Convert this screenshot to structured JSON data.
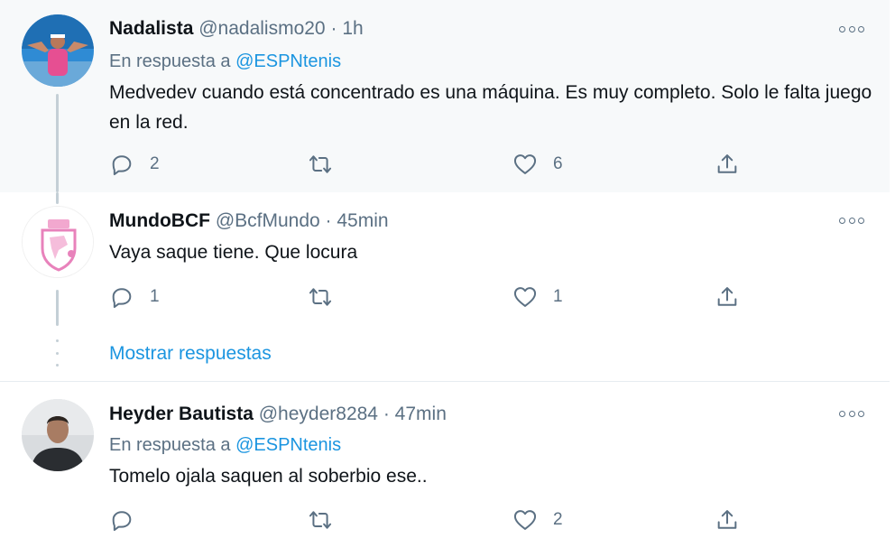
{
  "tweets": [
    {
      "name": "Nadalista",
      "handle": "@nadalismo20",
      "sep": "·",
      "time": "1h",
      "reply_prefix": "En respuesta a",
      "reply_to": "@ESPNtenis",
      "text": "Medvedev cuando está concentrado es una máquina. Es muy completo. Solo le falta juego en la red.",
      "replies": "2",
      "retweets": "",
      "likes": "6"
    },
    {
      "name": "MundoBCF",
      "handle": "@BcfMundo",
      "sep": "·",
      "time": "45min",
      "text": "Vaya saque tiene. Que locura",
      "replies": "1",
      "retweets": "",
      "likes": "1",
      "show_replies": "Mostrar respuestas"
    },
    {
      "name": "Heyder Bautista",
      "handle": "@heyder8284",
      "sep": "·",
      "time": "47min",
      "reply_prefix": "En respuesta a",
      "reply_to": "@ESPNtenis",
      "text": "Tomelo ojala saquen al soberbio ese..",
      "replies": "",
      "retweets": "",
      "likes": "2"
    }
  ],
  "icons": {
    "more": "more-horizontal-icon",
    "reply": "reply-icon",
    "retweet": "retweet-icon",
    "like": "heart-icon",
    "share": "share-icon"
  },
  "colors": {
    "accent": "#1b95e0",
    "secondary_text": "#5b7083",
    "highlight_bg": "#f7f9fa"
  }
}
